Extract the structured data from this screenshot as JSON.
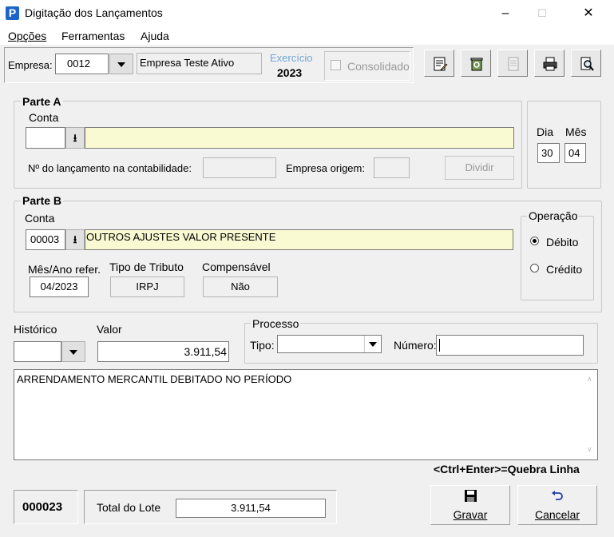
{
  "window": {
    "title": "Digitação dos Lançamentos",
    "app_icon_letter": "P",
    "minimize": "–",
    "maximize": "☐",
    "close": "✕"
  },
  "menu": {
    "items": [
      {
        "label": "Opções"
      },
      {
        "label": "Ferramentas"
      },
      {
        "label": "Ajuda"
      }
    ]
  },
  "header": {
    "empresa_label": "Empresa:",
    "empresa_code": "0012",
    "empresa_name": "Empresa Teste Ativo",
    "exercicio_label": "Exercício",
    "exercicio_value": "2023",
    "consolidado_label": "Consolidado",
    "exercicio_color": "#6fa6d8"
  },
  "toolbar": {
    "buttons": [
      {
        "icon": "edit-document-icon"
      },
      {
        "icon": "recycle-bin-icon"
      },
      {
        "icon": "disabled-document-icon"
      },
      {
        "icon": "printer-icon"
      },
      {
        "icon": "preview-search-icon"
      }
    ]
  },
  "parte_a": {
    "title": "Parte A",
    "conta_label": "Conta",
    "conta_code": "",
    "conta_desc": "",
    "lancamento_label": "Nº do lançamento na contabilidade:",
    "lancamento_value": "",
    "empresa_origem_label": "Empresa origem:",
    "empresa_origem_value": "",
    "dividir_label": "Dividir",
    "dia_label": "Dia",
    "dia_value": "30",
    "mes_label": "Mês",
    "mes_value": "04"
  },
  "parte_b": {
    "title": "Parte B",
    "conta_label": "Conta",
    "conta_code": "00003",
    "conta_desc": "OUTROS AJUSTES VALOR PRESENTE",
    "mes_ano_label": "Mês/Ano refer.",
    "mes_ano_value": "04/2023",
    "tipo_tributo_label": "Tipo de Tributo",
    "tipo_tributo_value": "IRPJ",
    "compensavel_label": "Compensável",
    "compensavel_value": "Não",
    "operacao_label": "Operação",
    "debito_label": "Débito",
    "credito_label": "Crédito",
    "selected": "Débito"
  },
  "lancamento": {
    "historico_label": "Histórico",
    "historico_value": "",
    "valor_label": "Valor",
    "valor_value": "3.911,54",
    "processo_label": "Processo",
    "tipo_label": "Tipo:",
    "tipo_value": "",
    "numero_label": "Número:",
    "numero_value": "",
    "historico_text": "ARRENDAMENTO MERCANTIL DEBITADO NO PERÍODO",
    "hint": "<Ctrl+Enter>=Quebra Linha"
  },
  "footer": {
    "lote_number": "000023",
    "total_lote_label": "Total do Lote",
    "total_lote_value": "3.911,54",
    "gravar_label": "Gravar",
    "cancelar_label": "Cancelar"
  }
}
